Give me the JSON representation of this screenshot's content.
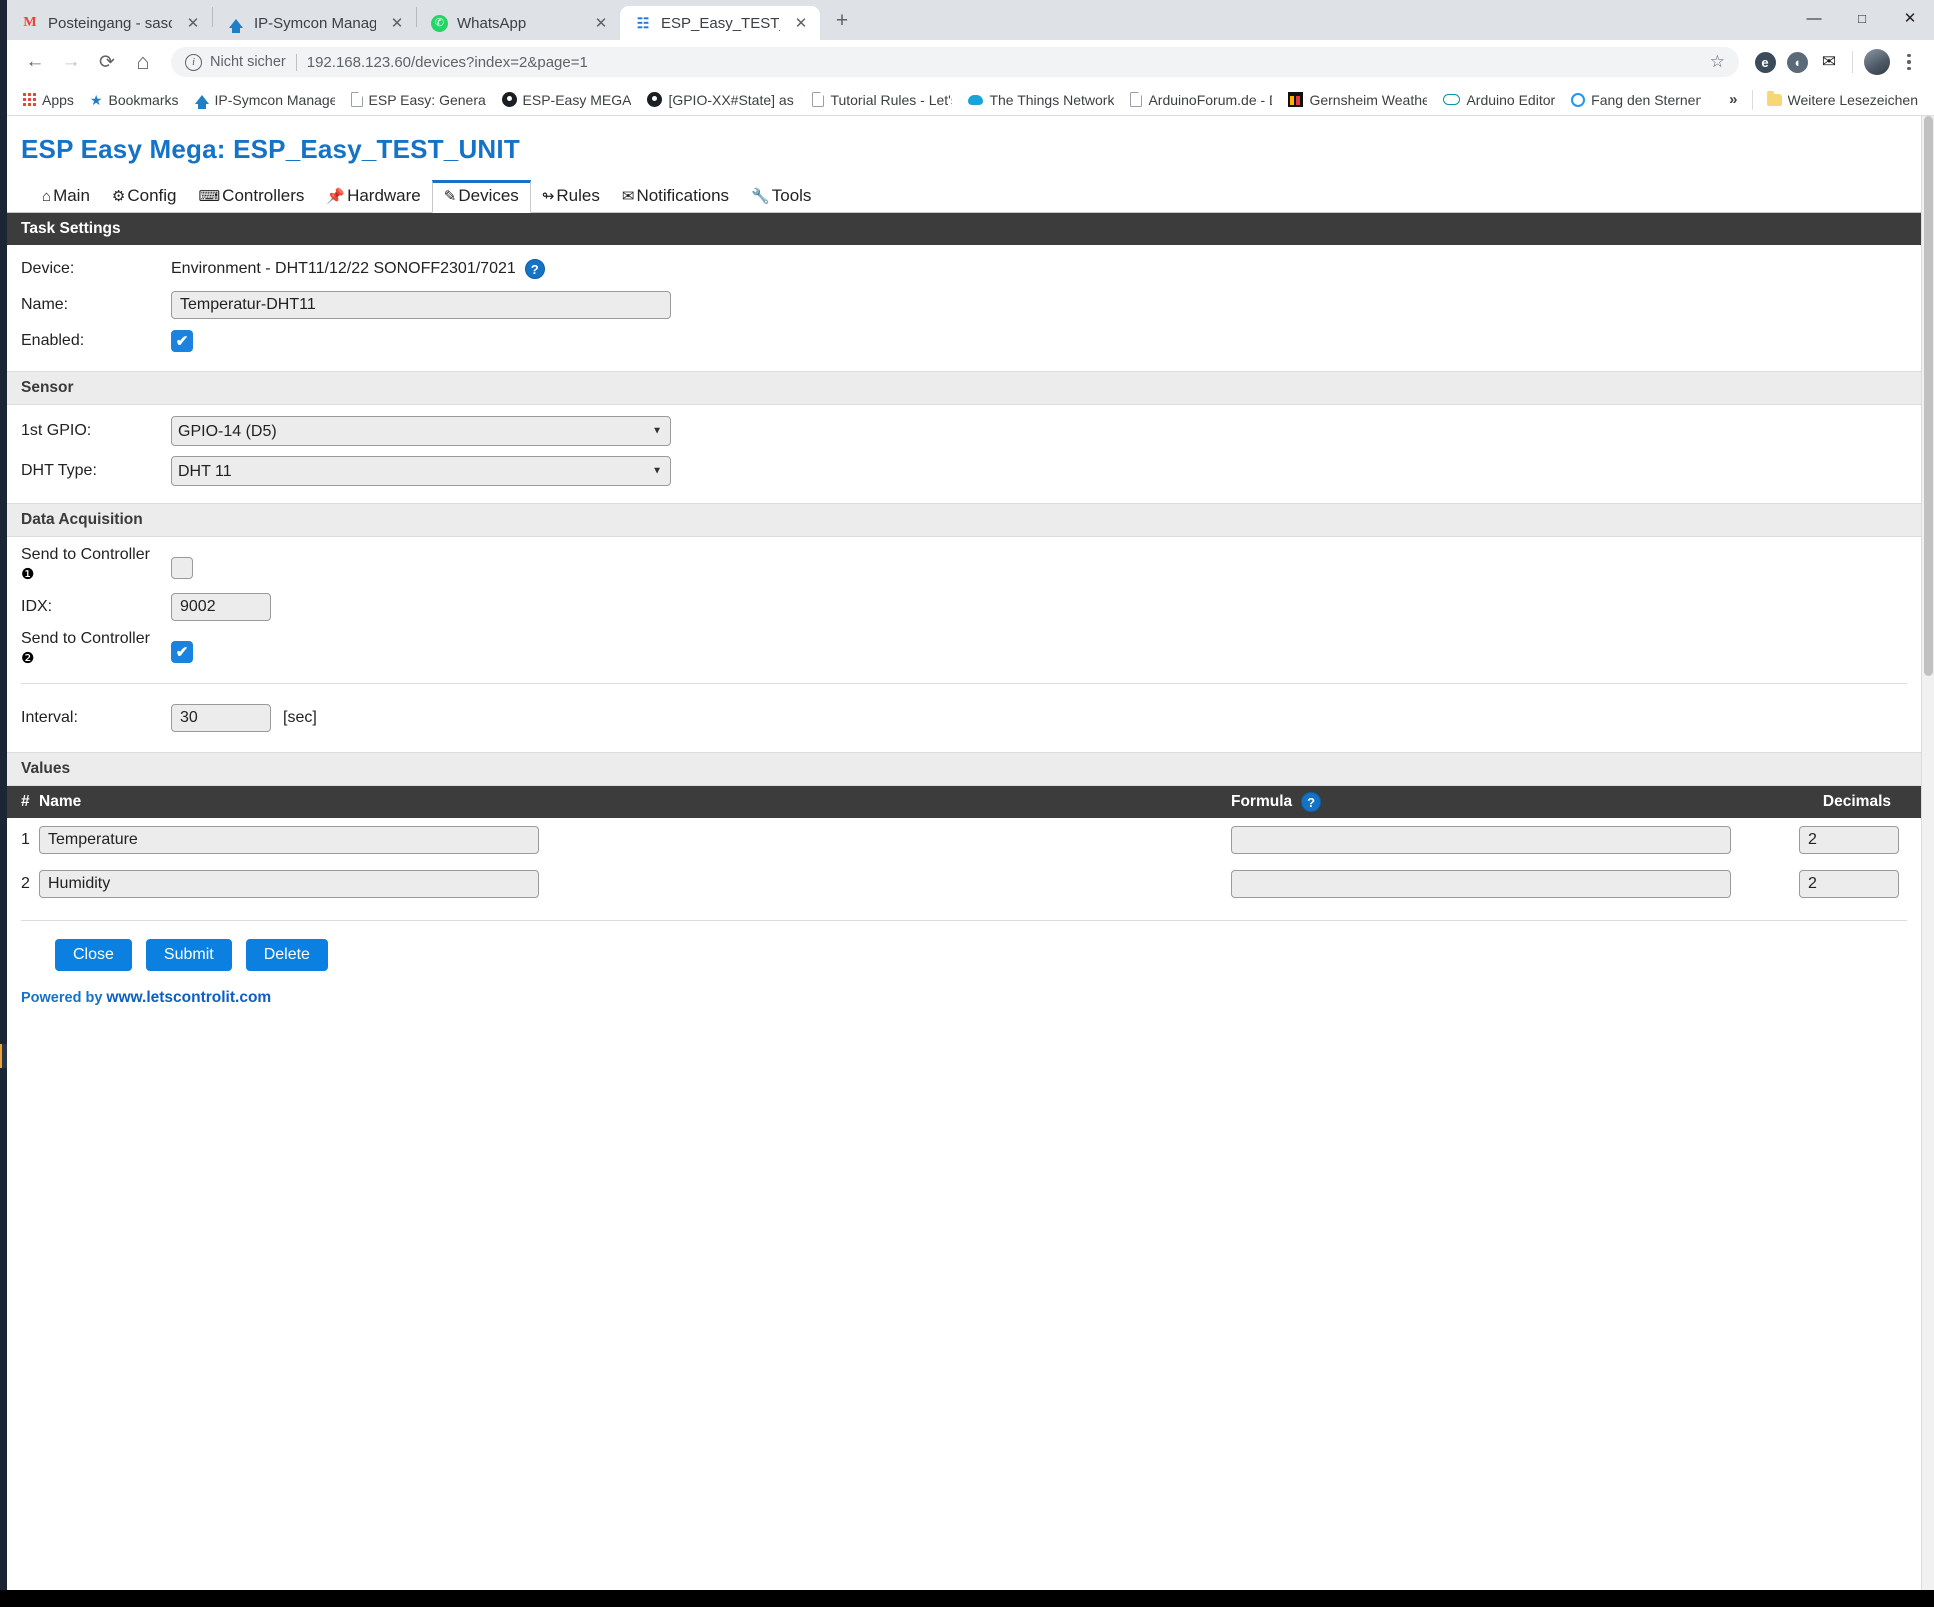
{
  "browser": {
    "tabs": [
      {
        "title": "Posteingang - saschagma@goog",
        "favicon": "gmail-icon",
        "active": false
      },
      {
        "title": "IP-Symcon Management Console",
        "favicon": "ipsymcon-icon",
        "active": false
      },
      {
        "title": "WhatsApp",
        "favicon": "whatsapp-icon",
        "active": false
      },
      {
        "title": "ESP_Easy_TEST_UNIT",
        "favicon": "espeasy-icon",
        "active": true
      }
    ],
    "new_tab_label": "+",
    "window_controls": {
      "minimize": "—",
      "maximize": "☐",
      "close": "✕"
    },
    "nav": {
      "back": "←",
      "forward": "→",
      "reload": "⟳",
      "home": "⌂"
    },
    "omnibox": {
      "security_label": "Nicht sicher",
      "url": "192.168.123.60/devices?index=2&page=1",
      "star": "☆"
    },
    "toolbar_extensions": [
      "e",
      "◔"
    ],
    "mail_icon": "✉",
    "bookmarks": [
      {
        "label": "Apps",
        "icon": "apps-grid-icon"
      },
      {
        "label": "Bookmarks",
        "icon": "star-icon"
      },
      {
        "label": "IP-Symcon Managem",
        "icon": "ipsymcon-icon"
      },
      {
        "label": "ESP Easy: General Dis",
        "icon": "document-icon"
      },
      {
        "label": "ESP-Easy MEGA",
        "icon": "github-icon"
      },
      {
        "label": "[GPIO-XX#State] as e",
        "icon": "github-icon"
      },
      {
        "label": "Tutorial Rules - Let's",
        "icon": "document-icon"
      },
      {
        "label": "The Things Network",
        "icon": "cloud-icon"
      },
      {
        "label": "ArduinoForum.de - D",
        "icon": "document-icon"
      },
      {
        "label": "Gernsheim Weather",
        "icon": "weather-icon"
      },
      {
        "label": "Arduino Editor",
        "icon": "arduino-icon"
      },
      {
        "label": "Fang den Sternenhim",
        "icon": "circle-icon"
      }
    ],
    "bookmarks_overflow": "»",
    "bookmarks_more": {
      "label": "Weitere Lesezeichen",
      "icon": "folder-icon"
    }
  },
  "app": {
    "title": "ESP Easy Mega: ESP_Easy_TEST_UNIT",
    "menu": [
      {
        "label": "Main",
        "icon": "⌂",
        "active": false
      },
      {
        "label": "Config",
        "icon": "⚙",
        "active": false
      },
      {
        "label": "Controllers",
        "icon": "⌨",
        "active": false
      },
      {
        "label": "Hardware",
        "icon": "📌",
        "active": false
      },
      {
        "label": "Devices",
        "icon": "✎",
        "active": true
      },
      {
        "label": "Rules",
        "icon": "↬",
        "active": false
      },
      {
        "label": "Notifications",
        "icon": "✉",
        "active": false
      },
      {
        "label": "Tools",
        "icon": "🔧",
        "active": false
      }
    ]
  },
  "task_settings": {
    "section_title": "Task Settings",
    "device_label": "Device:",
    "device_value": "Environment - DHT11/12/22 SONOFF2301/7021",
    "device_help": "?",
    "name_label": "Name:",
    "name_value": "Temperatur-DHT11",
    "enabled_label": "Enabled:",
    "enabled_checked": true
  },
  "sensor": {
    "section_title": "Sensor",
    "gpio_label": "1st GPIO:",
    "gpio_value": "GPIO-14 (D5)",
    "dht_label": "DHT Type:",
    "dht_value": "DHT 11"
  },
  "data_acquisition": {
    "section_title": "Data Acquisition",
    "controller1_label": "Send to Controller",
    "controller1_badge": "❶",
    "controller1_checked": false,
    "idx_label": "IDX:",
    "idx_value": "9002",
    "controller2_label": "Send to Controller",
    "controller2_badge": "❷",
    "controller2_checked": true,
    "interval_label": "Interval:",
    "interval_value": "30",
    "interval_unit": "[sec]"
  },
  "values": {
    "section_title": "Values",
    "columns": {
      "num": "#",
      "name": "Name",
      "formula": "Formula",
      "formula_help": "?",
      "decimals": "Decimals"
    },
    "rows": [
      {
        "num": "1",
        "name": "Temperature",
        "formula": "",
        "decimals": "2"
      },
      {
        "num": "2",
        "name": "Humidity",
        "formula": "",
        "decimals": "2"
      }
    ]
  },
  "buttons": {
    "close": "Close",
    "submit": "Submit",
    "delete": "Delete"
  },
  "footer": {
    "powered_prefix": "Powered by ",
    "powered_link": "www.letscontrolit.com"
  },
  "colors": {
    "accent": "#1473c6",
    "button": "#0b80e0",
    "section_dark": "#3c3c3c",
    "section_light": "#ececec"
  }
}
